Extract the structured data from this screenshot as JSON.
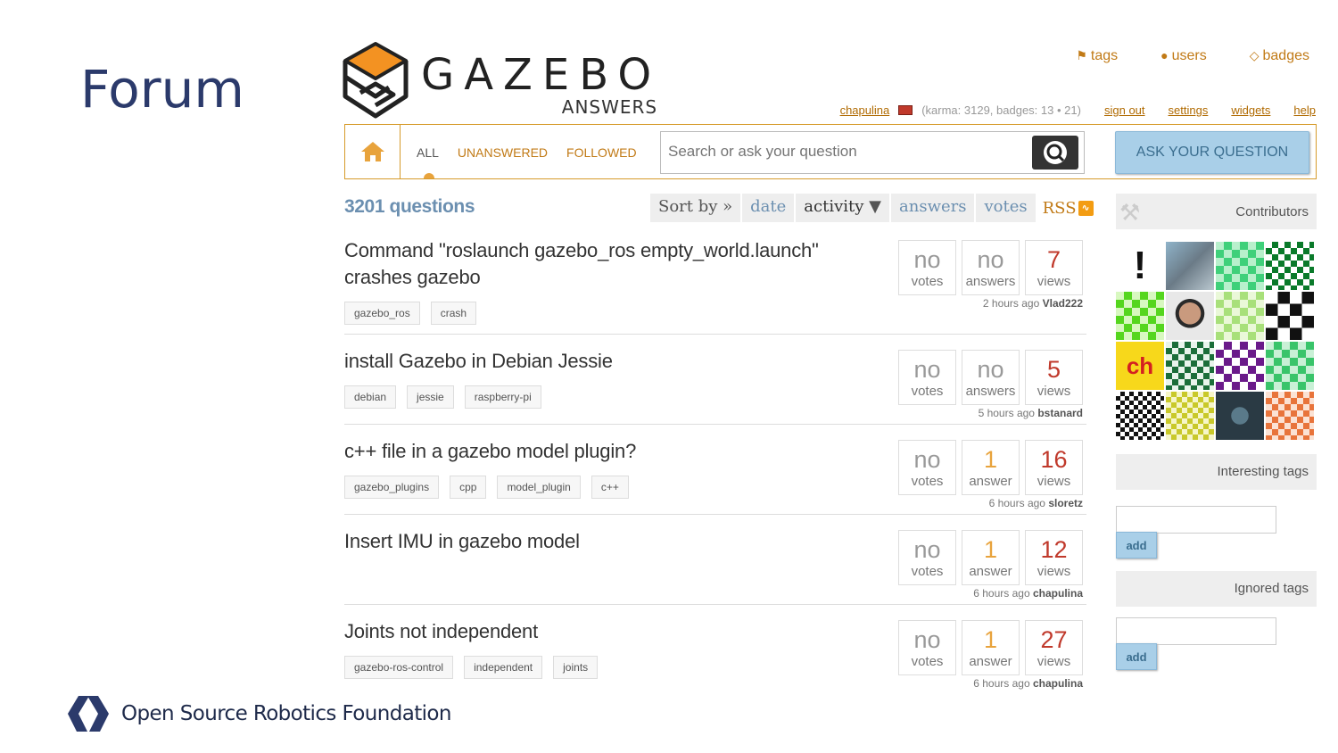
{
  "slide": {
    "title": "Forum",
    "footer": "Open Source Robotics Foundation"
  },
  "site": {
    "logo_main": "GAZEBO",
    "logo_sub": "ANSWERS"
  },
  "toplinks": {
    "tags": "tags",
    "users": "users",
    "badges": "badges"
  },
  "user": {
    "name": "chapulina",
    "karma": "(karma: 3129, badges: ",
    "silver": "13",
    "bronze": "21",
    "close": ")",
    "sign_out": "sign out",
    "settings": "settings",
    "widgets": "widgets",
    "help": "help"
  },
  "nav": {
    "scopes": [
      "ALL",
      "UNANSWERED",
      "FOLLOWED"
    ],
    "search_placeholder": "Search or ask your question",
    "ask_label": "ASK YOUR QUESTION"
  },
  "list": {
    "count": "3201 questions",
    "sort_label": "Sort by »",
    "sort_options": [
      "date",
      "activity",
      "answers",
      "votes"
    ],
    "active_sort": "activity",
    "rss": "RSS"
  },
  "questions": [
    {
      "title": "Command \"roslaunch gazebo_ros empty_world.launch\" crashes gazebo",
      "tags": [
        "gazebo_ros",
        "crash"
      ],
      "votes": "no",
      "votes_label": "votes",
      "answers": "no",
      "answers_label": "answers",
      "views": "7",
      "views_label": "views",
      "time": "2 hours ago",
      "user": "Vlad222"
    },
    {
      "title": "install Gazebo in Debian Jessie",
      "tags": [
        "debian",
        "jessie",
        "raspberry-pi"
      ],
      "votes": "no",
      "votes_label": "votes",
      "answers": "no",
      "answers_label": "answers",
      "views": "5",
      "views_label": "views",
      "time": "5 hours ago",
      "user": "bstanard"
    },
    {
      "title": "c++ file in a gazebo model plugin?",
      "tags": [
        "gazebo_plugins",
        "cpp",
        "model_plugin",
        "c++"
      ],
      "votes": "no",
      "votes_label": "votes",
      "answers": "1",
      "answers_label": "answer",
      "views": "16",
      "views_label": "views",
      "time": "6 hours ago",
      "user": "sloretz"
    },
    {
      "title": "Insert IMU in gazebo model",
      "tags": [],
      "votes": "no",
      "votes_label": "votes",
      "answers": "1",
      "answers_label": "answer",
      "views": "12",
      "views_label": "views",
      "time": "6 hours ago",
      "user": "chapulina"
    },
    {
      "title": "Joints not independent",
      "tags": [
        "gazebo-ros-control",
        "independent",
        "joints"
      ],
      "votes": "no",
      "votes_label": "votes",
      "answers": "1",
      "answers_label": "answer",
      "views": "27",
      "views_label": "views",
      "time": "6 hours ago",
      "user": "chapulina"
    }
  ],
  "sidebar": {
    "contributors": "Contributors",
    "interesting_tags": "Interesting tags",
    "ignored_tags": "Ignored tags",
    "add_label": "add"
  },
  "colors": {
    "accent": "#c17a16",
    "link_blue": "#6b8fb0",
    "button_blue": "#a9cfe8",
    "logo_orange": "#f39222"
  }
}
